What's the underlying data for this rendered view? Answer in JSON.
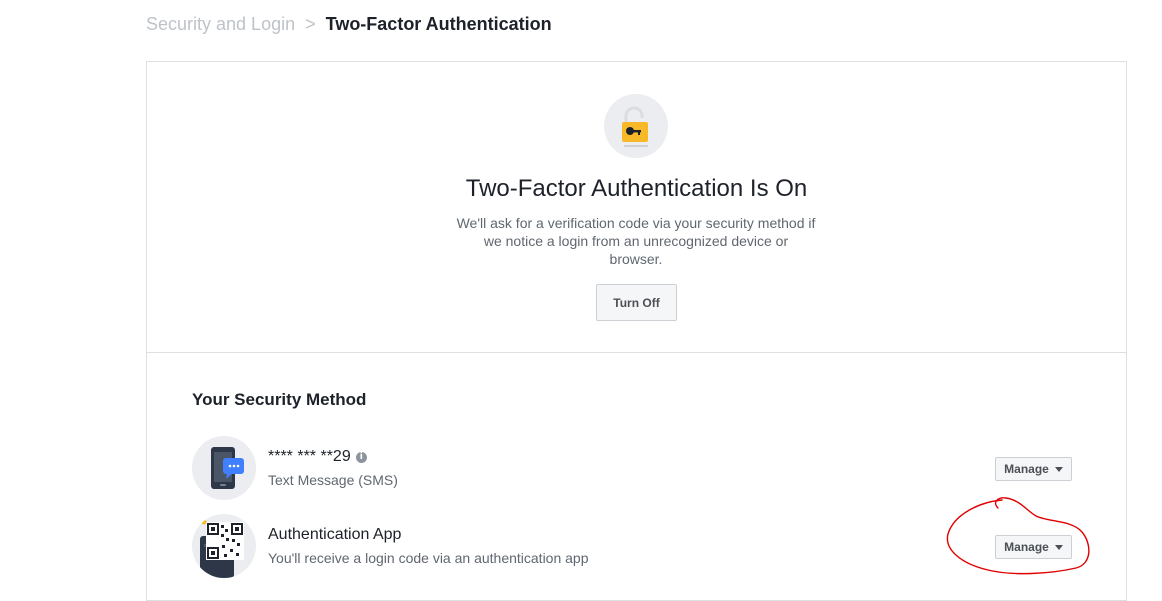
{
  "breadcrumb": {
    "parent": "Security and Login",
    "separator": ">",
    "current": "Two-Factor Authentication"
  },
  "status": {
    "title": "Two-Factor Authentication Is On",
    "description": "We'll ask for a verification code via your security method if we notice a login from an unrecognized device or browser.",
    "turn_off_label": "Turn Off"
  },
  "methods": {
    "title": "Your Security Method",
    "items": [
      {
        "title": "**** *** **29",
        "subtitle": "Text Message (SMS)",
        "manage_label": "Manage",
        "icon": "phone-message-icon"
      },
      {
        "title": "Authentication App",
        "subtitle": "You'll receive a login code via an authentication app",
        "manage_label": "Manage",
        "icon": "qr-code-icon"
      }
    ]
  },
  "colors": {
    "annotation": "#e00000",
    "lock": "#f7b928",
    "accent": "#4080ff"
  }
}
